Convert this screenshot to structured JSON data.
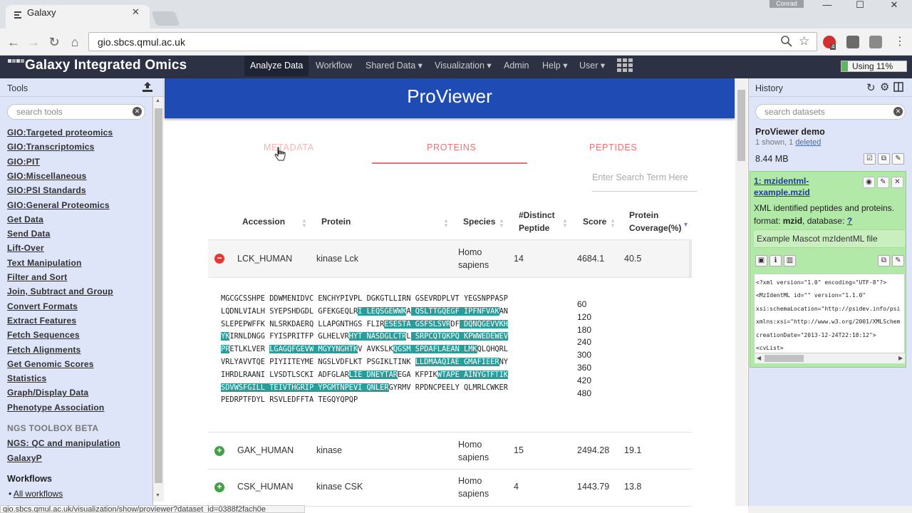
{
  "browser": {
    "tab_title": "Galaxy",
    "tab_close": "✕",
    "user_chip": "Conrad",
    "url": "gio.sbcs.qmul.ac.uk",
    "ext_badge": "4"
  },
  "masthead": {
    "brand": "Galaxy Integrated Omics",
    "menu": [
      "Analyze Data",
      "Workflow",
      "Shared Data",
      "Visualization",
      "Admin",
      "Help",
      "User"
    ],
    "usage": "Using 11%",
    "usage_fraction": 0.11
  },
  "tools": {
    "title": "Tools",
    "search_placeholder": "search tools",
    "categories": [
      "GIO:Targeted proteomics",
      "GIO:Transcriptomics",
      "GIO:PIT",
      "GIO:Miscellaneous",
      "GIO:PSI Standards",
      "GIO:General Proteomics",
      "Get Data",
      "Send Data",
      "Lift-Over",
      "Text Manipulation",
      "Filter and Sort",
      "Join, Subtract and Group",
      "Convert Formats",
      "Extract Features",
      "Fetch Sequences",
      "Fetch Alignments",
      "Get Genomic Scores",
      "Statistics",
      "Graph/Display Data",
      "Phenotype Association"
    ],
    "ngs_header": "NGS TOOLBOX BETA",
    "ngs_items": [
      "NGS: QC and manipulation",
      "GalaxyP"
    ],
    "workflows_header": "Workflows",
    "all_workflows": "All workflows"
  },
  "proviewer": {
    "title": "ProViewer",
    "tabs": [
      "METADATA",
      "PROTEINS",
      "PEPTIDES"
    ],
    "search_placeholder": "Enter Search Term Here",
    "columns": [
      "Accession",
      "Protein",
      "Species",
      "#Distinct Peptide",
      "Score",
      "Protein Coverage(%)"
    ],
    "rows": [
      {
        "accession": "LCK_HUMAN",
        "protein": "kinase Lck",
        "species": "Homo sapiens",
        "peptides": "14",
        "score": "4684.1",
        "coverage": "40.5",
        "expanded": true
      },
      {
        "accession": "GAK_HUMAN",
        "protein": "kinase",
        "species": "Homo sapiens",
        "peptides": "15",
        "score": "2494.28",
        "coverage": "19.1",
        "expanded": false
      },
      {
        "accession": "CSK_HUMAN",
        "protein": "kinase CSK",
        "species": "Homo sapiens",
        "peptides": "4",
        "score": "1443.79",
        "coverage": "13.8",
        "expanded": false
      }
    ],
    "sequence_numbers": [
      "60",
      "120",
      "180",
      "240",
      "300",
      "360",
      "420",
      "480"
    ],
    "highlight_color": "#2a9d9a"
  },
  "history": {
    "title": "History",
    "search_placeholder": "search datasets",
    "name": "ProViewer demo",
    "shown": "1 shown, 1",
    "deleted": "deleted",
    "size": "8.44 MB",
    "dataset": {
      "title": "1: mzidentml-example.mzid",
      "description": "XML identified peptides and proteins.",
      "format_label": "format:",
      "format": "mzid",
      "database_label": ", database:",
      "database": "?",
      "info": "Example Mascot mzIdentML file",
      "peek_lines": [
        "<?xml version=\"1.0\" encoding=\"UTF-8\"?>",
        "<MzIdentML id=\"\" version=\"1.1.0\"",
        "xsi:schemaLocation=\"http://psidev.info/psi",
        "xmlns:xsi=\"http://www.w3.org/2001/XMLSchem",
        "creationDate=\"2013-12-24T22:18:12\">",
        "<cvList>"
      ]
    }
  },
  "statusbar": "gio.sbcs.qmul.ac.uk/visualization/show/proviewer?dataset_id=0388f2fach0e"
}
